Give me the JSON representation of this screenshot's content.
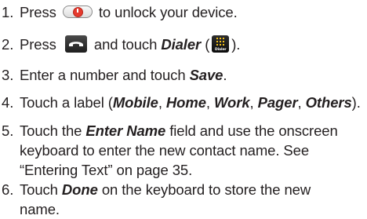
{
  "steps": [
    {
      "number": "1.",
      "before": "Press",
      "after": "to unlock your device."
    },
    {
      "number": "2.",
      "before": "Press",
      "middle": "and touch",
      "app_name": "Dialer",
      "paren_open": "(",
      "paren_close": ")."
    },
    {
      "number": "3.",
      "before": "Enter a number and touch",
      "action": "Save",
      "after": "."
    },
    {
      "number": "4.",
      "before": "Touch a label (",
      "labels": [
        "Mobile",
        "Home",
        "Work",
        "Pager",
        "Others"
      ],
      "separator": ", ",
      "after": ")."
    },
    {
      "number": "5.",
      "before": "Touch the",
      "field": "Enter Name",
      "line1_after": "field and use the onscreen",
      "line2": "keyboard to enter the new contact name. See",
      "line3": "“Entering Text” on page 35."
    },
    {
      "number": "6.",
      "before": "Touch",
      "action": "Done",
      "line1_after": "on the keyboard to store the new",
      "line2": "name."
    }
  ],
  "icons": {
    "power_key": "power-key-icon",
    "talk_key": "talk-key-icon",
    "dialer": "dialer-app-icon",
    "dialer_caption": "Dialer"
  },
  "colors": {
    "text": "#231f20",
    "power_red": "#e53a2e",
    "dialer_keys": "#f3c11b"
  }
}
